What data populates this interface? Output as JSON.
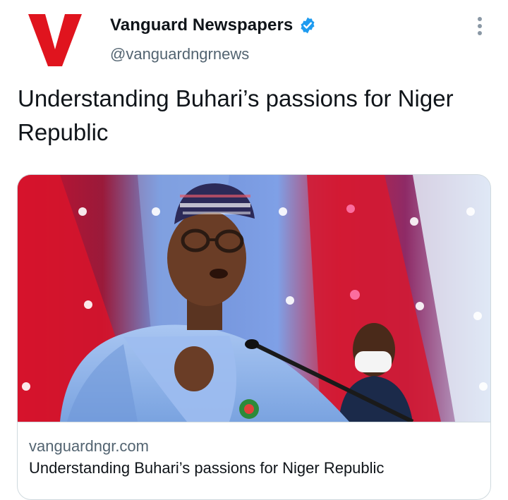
{
  "author": {
    "name": "Vanguard Newspapers",
    "handle": "@vanguardngrnews",
    "verified_icon": "verified-badge-icon",
    "avatar_icon": "vanguard-v-logo",
    "brand_color": "#e0141e",
    "verified_color": "#1d9bf0"
  },
  "menu": {
    "icon": "more-vertical-icon"
  },
  "tweet": {
    "text": "Understanding Buhari’s passions for Niger Republic"
  },
  "card": {
    "domain": "vanguardngr.com",
    "title": "Understanding Buhari’s passions for Niger Republic"
  }
}
